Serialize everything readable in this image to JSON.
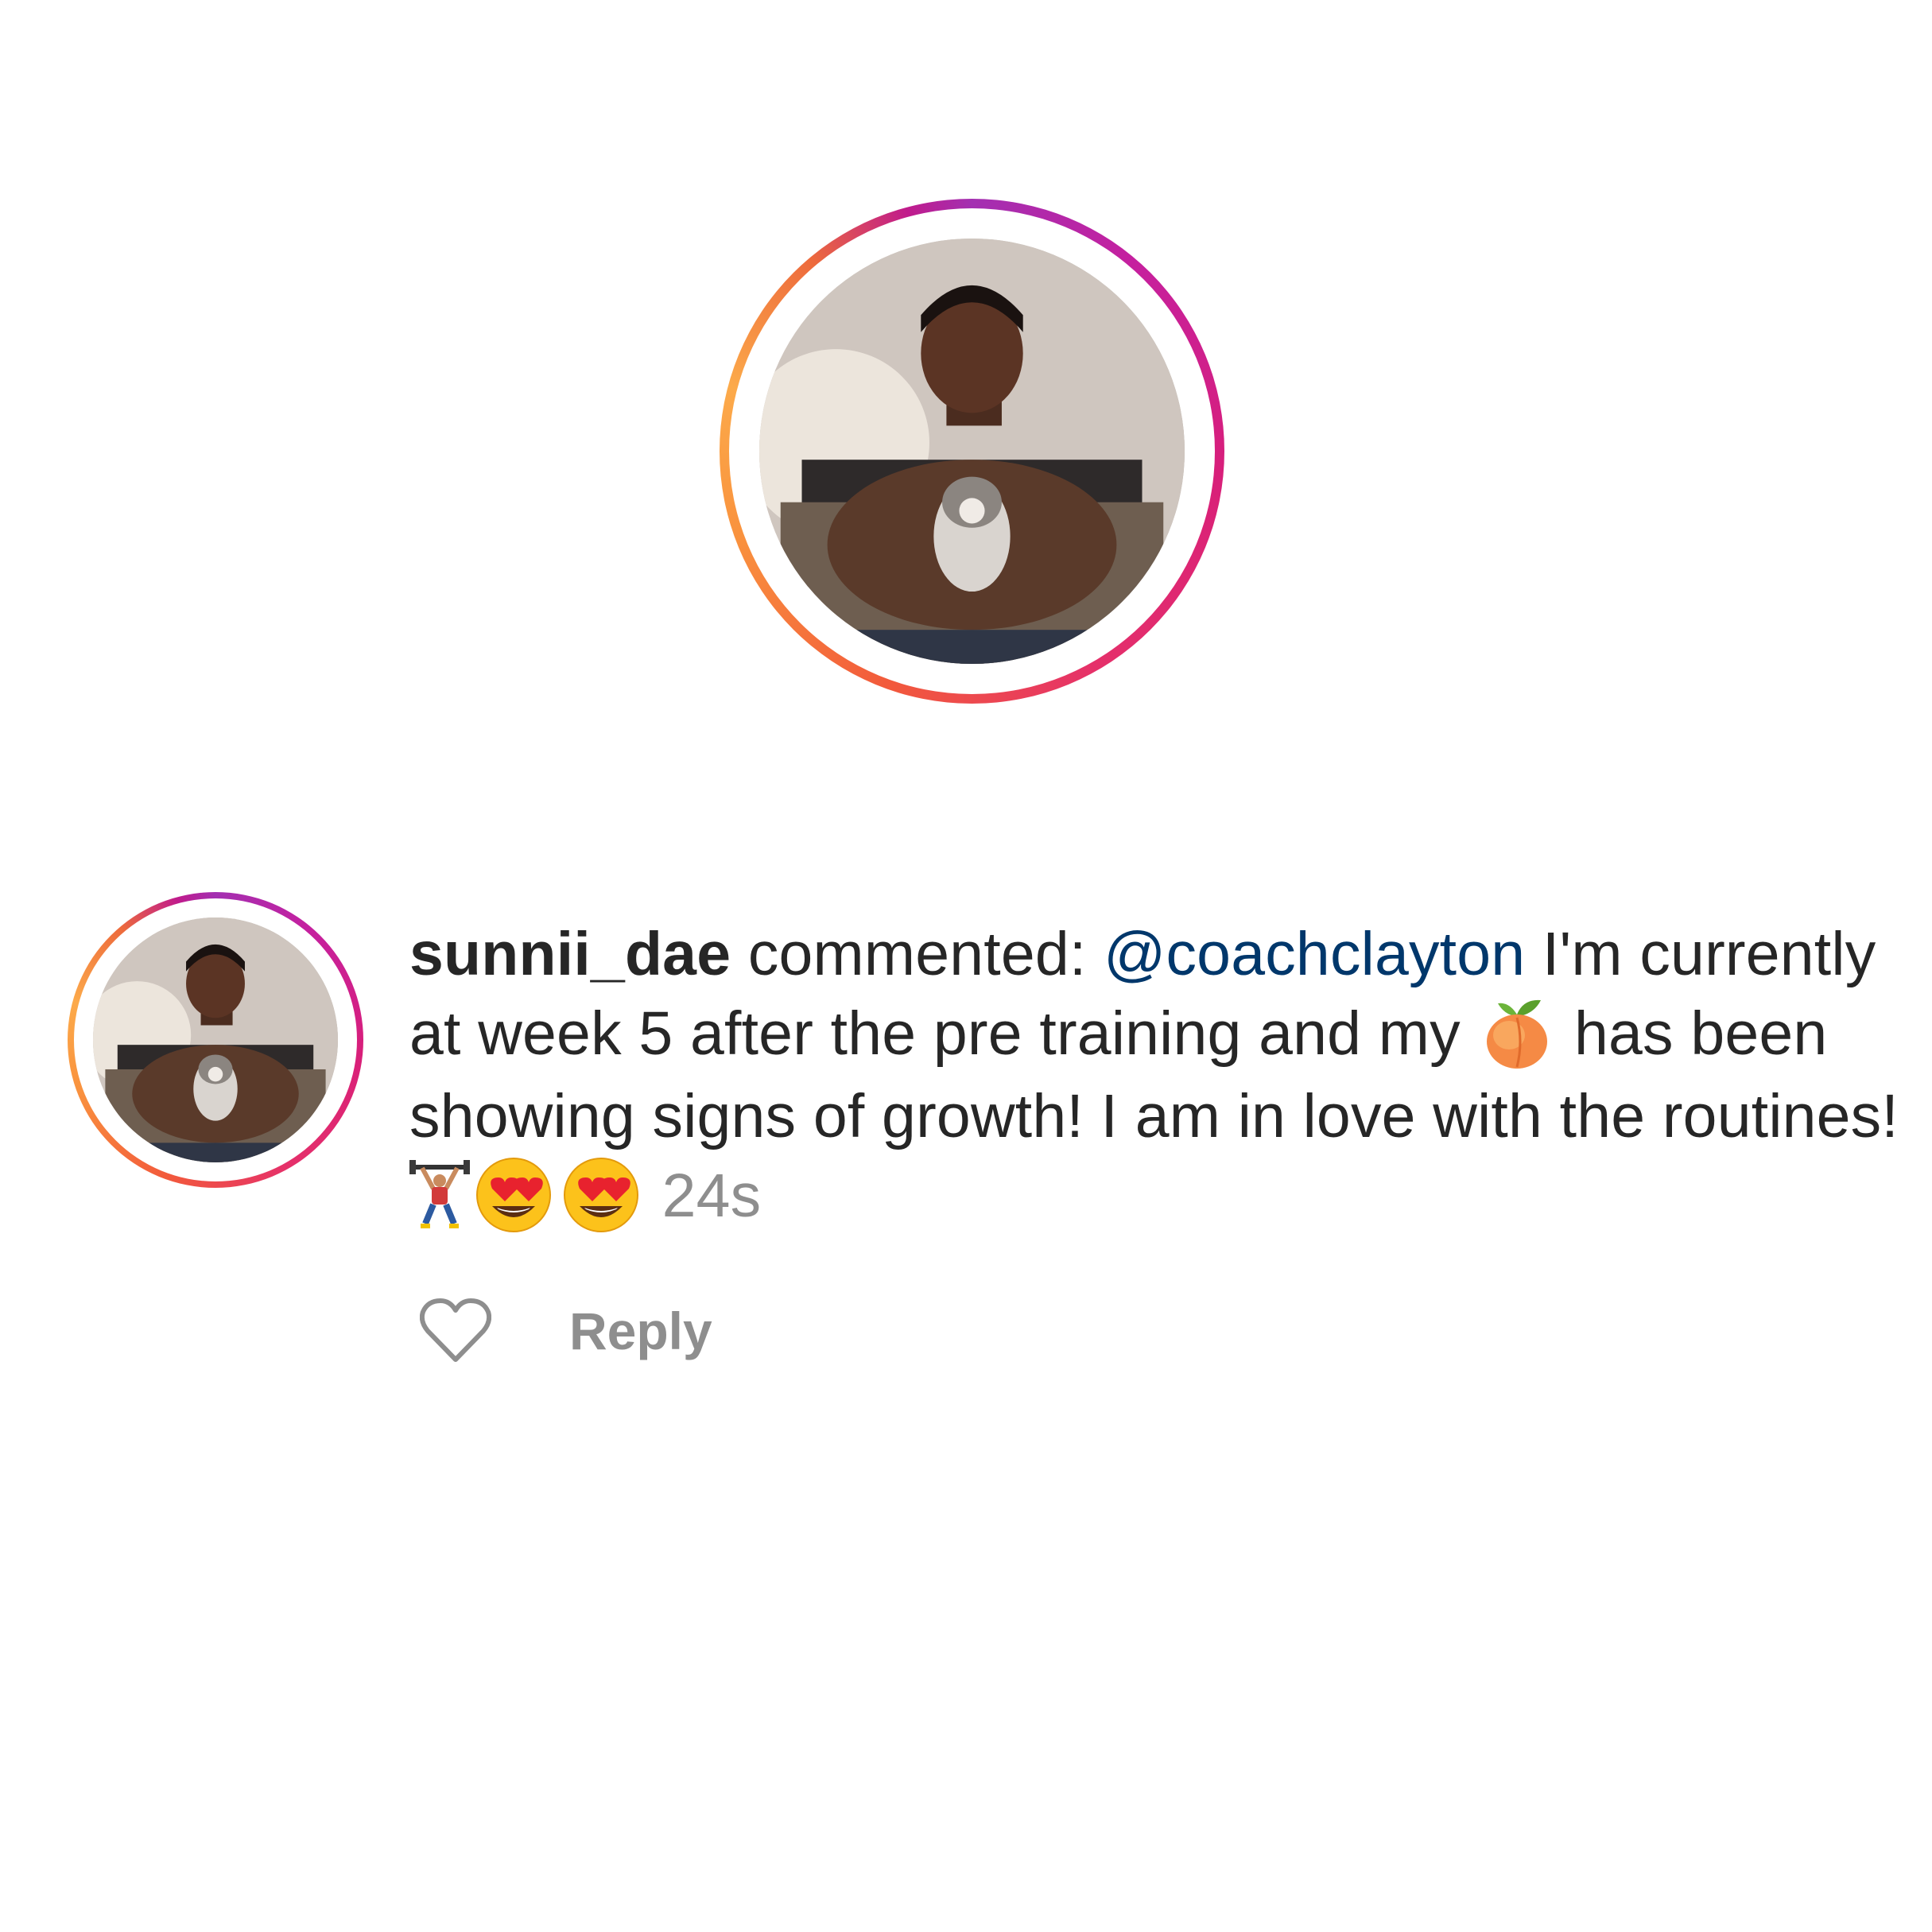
{
  "comment": {
    "username": "sunnii_dae",
    "action_text": " commented: ",
    "mention": "@coachclayton",
    "body_part1": " I'm currently at week 5 after the pre training and my ",
    "body_part2": " has been showing signs of growth! I am in love with the routines!",
    "timestamp": "24s",
    "emojis": [
      "peach-emoji",
      "weightlifter-emoji",
      "heart-eyes-emoji",
      "heart-eyes-emoji"
    ]
  },
  "actions": {
    "like_icon": "heart-outline-icon",
    "reply_label": "Reply"
  },
  "colors": {
    "username": "#262626",
    "text": "#262626",
    "mention": "#00376b",
    "muted": "#8e8e8e",
    "ring_start": "#a32fb1",
    "ring_mid": "#e5306a",
    "ring_end": "#fcaa4a"
  }
}
